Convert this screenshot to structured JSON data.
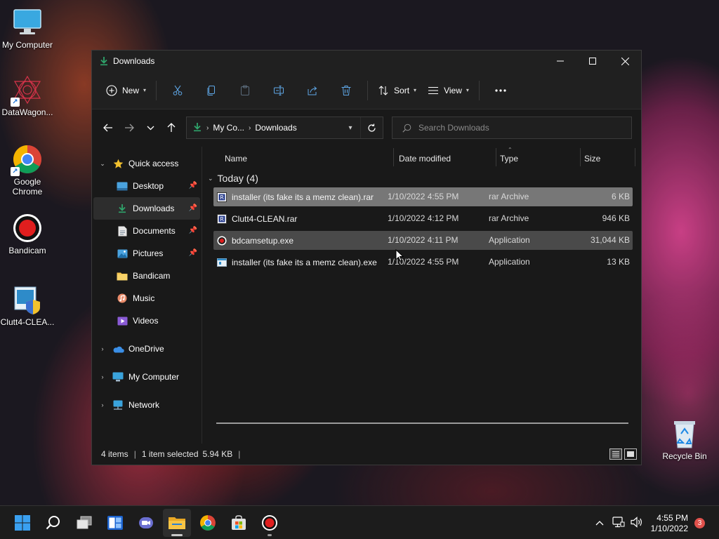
{
  "desktop": {
    "icons": [
      {
        "label": "My Computer"
      },
      {
        "label": "DataWagon..."
      },
      {
        "label": "Google Chrome"
      },
      {
        "label": "Bandicam"
      },
      {
        "label": "Clutt4-CLEA..."
      },
      {
        "label": "Recycle Bin"
      }
    ]
  },
  "window": {
    "title": "Downloads",
    "icon": "download-icon"
  },
  "toolbar": {
    "new_label": "New",
    "sort_label": "Sort",
    "view_label": "View",
    "icons": [
      "cut-icon",
      "copy-icon",
      "paste-icon",
      "rename-icon",
      "share-icon",
      "delete-icon",
      "more-icon"
    ]
  },
  "address": {
    "crumb_1": "My Co...",
    "crumb_2": "Downloads",
    "search_placeholder": "Search Downloads"
  },
  "sidebar": {
    "quick_access": "Quick access",
    "items": [
      {
        "label": "Desktop",
        "pinned": true
      },
      {
        "label": "Downloads",
        "pinned": true,
        "selected": true
      },
      {
        "label": "Documents",
        "pinned": true
      },
      {
        "label": "Pictures",
        "pinned": true
      },
      {
        "label": "Bandicam",
        "pinned": false
      },
      {
        "label": "Music",
        "pinned": false
      },
      {
        "label": "Videos",
        "pinned": false
      }
    ],
    "onedrive": "OneDrive",
    "my_computer": "My Computer",
    "network": "Network"
  },
  "columns": {
    "name": "Name",
    "date": "Date modified",
    "type": "Type",
    "size": "Size"
  },
  "group": {
    "label": "Today (4)"
  },
  "files": [
    {
      "name": "installer (its fake its a memz clean).rar",
      "date": "1/10/2022 4:55 PM",
      "type": "rar Archive",
      "size": "6 KB"
    },
    {
      "name": "Clutt4-CLEAN.rar",
      "date": "1/10/2022 4:12 PM",
      "type": "rar Archive",
      "size": "946 KB"
    },
    {
      "name": "bdcamsetup.exe",
      "date": "1/10/2022 4:11 PM",
      "type": "Application",
      "size": "31,044 KB"
    },
    {
      "name": "installer (its fake its a memz clean).exe",
      "date": "1/10/2022 4:55 PM",
      "type": "Application",
      "size": "13 KB"
    }
  ],
  "status": {
    "items": "4 items",
    "selected": "1 item selected",
    "selected_size": "5.94 KB"
  },
  "taskbar": {
    "time": "4:55 PM",
    "date": "1/10/2022",
    "notifications": "3"
  },
  "colors": {
    "window_bg": "#191919",
    "selected_row": "#777777",
    "accent": "#2fa46b"
  }
}
